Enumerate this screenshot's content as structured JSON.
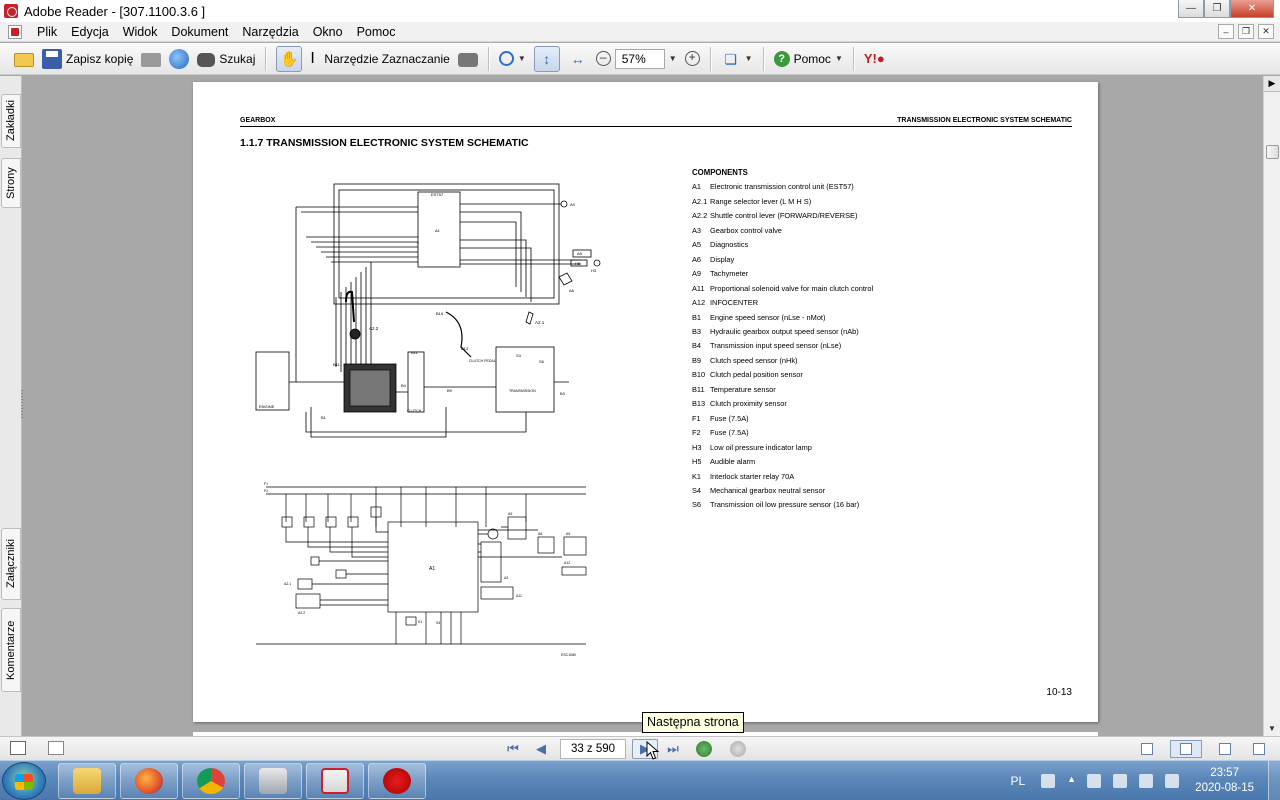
{
  "window": {
    "title": "Adobe Reader - [307.1100.3.6 ]"
  },
  "menu": [
    "Plik",
    "Edycja",
    "Widok",
    "Dokument",
    "Narzędzia",
    "Okno",
    "Pomoc"
  ],
  "toolbar": {
    "save_copy": "Zapisz kopię",
    "search": "Szukaj",
    "select_tool": "Narzędzie Zaznaczanie",
    "zoom": "57%",
    "help": "Pomoc"
  },
  "left_tabs": {
    "bookmarks": "Zakładki",
    "pages": "Strony",
    "attachments": "Załączniki",
    "comments": "Komentarze"
  },
  "page": {
    "header_left": "GEARBOX",
    "header_right": "TRANSMISSION ELECTRONIC SYSTEM SCHEMATIC",
    "section_title": "1.1.7 TRANSMISSION ELECTRONIC SYSTEM SCHEMATIC",
    "components_title": "COMPONENTS",
    "components": [
      {
        "code": "A1",
        "text": "Electronic transmission control unit (EST57)"
      },
      {
        "code": "A2.1",
        "text": "Range selector lever (L M H S)"
      },
      {
        "code": "A2.2",
        "text": "Shuttle control lever (FORWARD/REVERSE)"
      },
      {
        "code": "A3",
        "text": "Gearbox control valve"
      },
      {
        "code": "A5",
        "text": "Diagnostics"
      },
      {
        "code": "A6",
        "text": "Display"
      },
      {
        "code": "A9",
        "text": "Tachymeter"
      },
      {
        "code": "A11",
        "text": "Proportional solenoid valve for main clutch control"
      },
      {
        "code": "A12",
        "text": "INFOCENTER"
      },
      {
        "code": "B1",
        "text": "Engine speed sensor (nLse - nMot)"
      },
      {
        "code": "B3",
        "text": "Hydraulic gearbox output speed sensor (nAb)"
      },
      {
        "code": "B4",
        "text": "Transmission input speed sensor (nLse)"
      },
      {
        "code": "B9",
        "text": "Clutch speed sensor (nHk)"
      },
      {
        "code": "B10",
        "text": "Clutch pedal position sensor"
      },
      {
        "code": "B11",
        "text": "Temperature sensor"
      },
      {
        "code": "B13",
        "text": "Clutch proximity sensor"
      },
      {
        "code": "F1",
        "text": "Fuse (7.5A)"
      },
      {
        "code": "F2",
        "text": "Fuse (7.5A)"
      },
      {
        "code": "H3",
        "text": "Low oil pressure indicator lamp"
      },
      {
        "code": "H5",
        "text": "Audible alarm"
      },
      {
        "code": "K1",
        "text": "Interlock starter relay 70A"
      },
      {
        "code": "S4",
        "text": "Mechanical gearbox neutral sensor"
      },
      {
        "code": "S6",
        "text": "Transmission oil low pressure sensor (16 bar)"
      }
    ],
    "diagram_labels": {
      "engine": "ENGINE",
      "clutch": "CLUTCH",
      "transmission": "TRANSMISSION",
      "clutch_pedal": "CLUTCH PEDAL",
      "est57": "EST57",
      "a1": "A1",
      "a21": "A2.1",
      "a22": "A2.2",
      "a3": "A3",
      "a5": "A5",
      "a6": "A6",
      "a9": "A9",
      "a11": "A11",
      "a12": "A12",
      "h3": "H3",
      "h5": "H5",
      "b1": "B1",
      "b3": "B3",
      "b4": "B4",
      "b9": "B9",
      "b10": "B10",
      "b11": "B11",
      "b13": "B13",
      "s4": "S4",
      "s6": "S6",
      "k1": "K1",
      "f1": "F1",
      "f2": "F2",
      "code": "ESC1080"
    },
    "page_number": "10-13"
  },
  "navigation": {
    "page_field": "33 z 590",
    "tooltip": "Następna strona"
  },
  "taskbar": {
    "lang": "PL",
    "time": "23:57",
    "date": "2020-08-15"
  }
}
